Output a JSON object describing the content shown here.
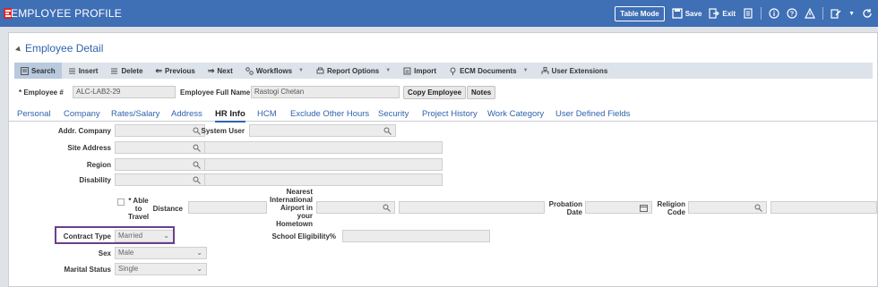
{
  "window": {
    "title": "EMPLOYEE PROFILE",
    "table_mode_label": "Table Mode",
    "save_label": "Save",
    "exit_label": "Exit"
  },
  "section": {
    "title": "Employee Detail"
  },
  "toolbar": {
    "search": "Search",
    "insert": "Insert",
    "delete": "Delete",
    "previous": "Previous",
    "next": "Next",
    "workflows": "Workflows",
    "report_options": "Report Options",
    "import": "Import",
    "ecm_documents": "ECM Documents",
    "user_extensions": "User Extensions"
  },
  "employee": {
    "id_label": "* Employee #",
    "id_value": "ALC-LAB2-29",
    "name_label": "Employee Full Name",
    "name_value": "Rastogi Chetan",
    "copy_button": "Copy Employee",
    "notes_button": "Notes"
  },
  "tabs": [
    "Personal",
    "Company",
    "Rates/Salary",
    "Address",
    "HR Info",
    "HCM",
    "Exclude Other Hours",
    "Security",
    "Project History",
    "Work Category",
    "User Defined Fields"
  ],
  "active_tab": "HR Info",
  "form": {
    "addr_company": "Addr. Company",
    "system_user": "System User",
    "site_address": "Site Address",
    "region": "Region",
    "disability": "Disability",
    "able_to_travel_1": "* Able",
    "able_to_travel_2": "to",
    "able_to_travel_3": "Travel",
    "distance": "Distance",
    "airport_1": "Nearest",
    "airport_2": "International",
    "airport_3": "Airport in",
    "airport_4": "your",
    "airport_5": "Hometown",
    "probation_1": "Probation",
    "probation_2": "Date",
    "religion_1": "Religion",
    "religion_2": "Code",
    "contract_type": "Contract Type",
    "contract_type_value": "Married",
    "school_eligibility": "School Eligibility%",
    "sex": "Sex",
    "sex_value": "Male",
    "marital_status": "Marital Status",
    "marital_status_value": "Single"
  },
  "colors": {
    "titlebar": "#3f6fb5",
    "link": "#2f63ad",
    "highlight": "#6b3f8f"
  }
}
